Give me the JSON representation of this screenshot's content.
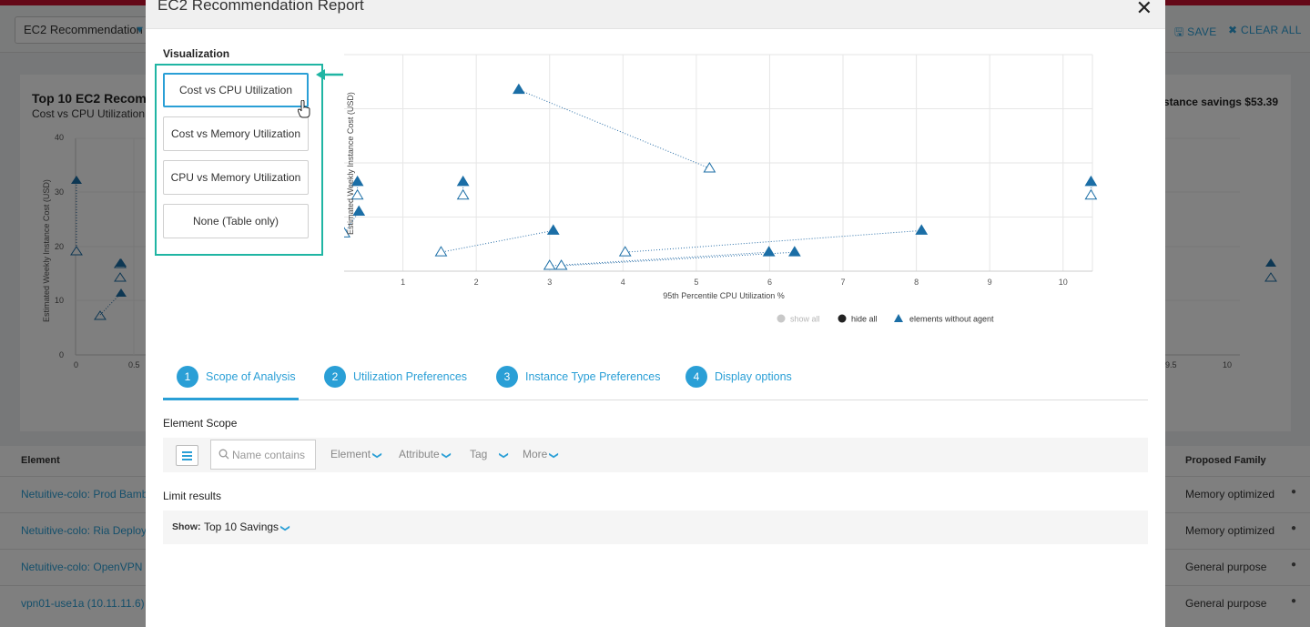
{
  "background": {
    "selector_label": "EC2 Recommendation",
    "save_label": "SAVE",
    "clear_label": "CLEAR ALL",
    "card_title": "Top 10 EC2 Recomm",
    "card_subtitle": "Cost vs CPU Utilization",
    "card_right": "instance savings $53.39",
    "table_headers": {
      "element": "Element",
      "proposed_family": "Proposed Family"
    },
    "rows": [
      {
        "element": "Netuitive-colo: Prod Bamb",
        "family": "Memory optimized"
      },
      {
        "element": "Netuitive-colo: Ria Deploys",
        "family": "Memory optimized"
      },
      {
        "element": "Netuitive-colo: OpenVPN S",
        "family": "General purpose"
      },
      {
        "element": "vpn01-use1a (10.11.11.6)",
        "family": "General purpose"
      }
    ]
  },
  "modal": {
    "title": "EC2 Recommendation Report",
    "visualization": {
      "label": "Visualization",
      "options": [
        {
          "label": "Cost vs CPU Utilization",
          "active": true
        },
        {
          "label": "Cost vs Memory Utilization",
          "active": false
        },
        {
          "label": "CPU vs Memory Utilization",
          "active": false
        },
        {
          "label": "None (Table only)",
          "active": false
        }
      ]
    },
    "legend": {
      "show_all": "show all",
      "hide_all": "hide all",
      "without_agent": "elements without agent"
    },
    "tabs": [
      {
        "num": "1",
        "label": "Scope of Analysis",
        "active": true
      },
      {
        "num": "2",
        "label": "Utilization Preferences",
        "active": false
      },
      {
        "num": "3",
        "label": "Instance Type Preferences",
        "active": false
      },
      {
        "num": "4",
        "label": "Display options",
        "active": false
      }
    ],
    "element_scope": {
      "label": "Element Scope",
      "name_placeholder": "Name contains",
      "filters": [
        "Element",
        "Attribute",
        "Tag",
        "More"
      ]
    },
    "limit_results": {
      "label": "Limit results",
      "show_label": "Show:",
      "show_value": "Top 10 Savings"
    }
  },
  "colors": {
    "accent": "#2a9fd6",
    "marker": "#1b6ea6",
    "highlight": "#1fb5a3"
  },
  "chart_data": {
    "type": "scatter",
    "title": "",
    "xlabel": "95th Percentile CPU Utilization %",
    "ylabel": "Estimated Weekly Instance Cost (USD)",
    "xlim": [
      0,
      10.4
    ],
    "ylim": [
      0,
      40
    ],
    "x_ticks": [
      0,
      1,
      2,
      3,
      4,
      5,
      6,
      7,
      8,
      9,
      10
    ],
    "y_ticks": [
      0,
      10,
      20,
      30,
      40
    ],
    "grid": true,
    "legend_position": "bottom",
    "pairs": [
      {
        "current": [
          0,
          32
        ],
        "proposed": [
          0,
          19
        ]
      },
      {
        "current": [
          0.38,
          16.5
        ],
        "proposed": [
          0.38,
          14
        ]
      },
      {
        "current": [
          0.4,
          11
        ],
        "proposed": [
          0.2,
          7
        ]
      },
      {
        "current": [
          1.82,
          16.5
        ],
        "proposed": [
          1.82,
          14
        ]
      },
      {
        "current": [
          2.58,
          33.5
        ],
        "proposed": [
          5.18,
          19
        ]
      },
      {
        "current": [
          3.05,
          7.5
        ],
        "proposed": [
          1.52,
          3.5
        ]
      },
      {
        "current": [
          5.99,
          3.5
        ],
        "proposed": [
          3.0,
          1
        ]
      },
      {
        "current": [
          6.34,
          3.5
        ],
        "proposed": [
          3.16,
          1
        ]
      },
      {
        "current": [
          8.07,
          7.5
        ],
        "proposed": [
          4.03,
          3.5
        ]
      },
      {
        "current": [
          10.38,
          16.5
        ],
        "proposed": [
          10.38,
          14
        ]
      }
    ]
  }
}
